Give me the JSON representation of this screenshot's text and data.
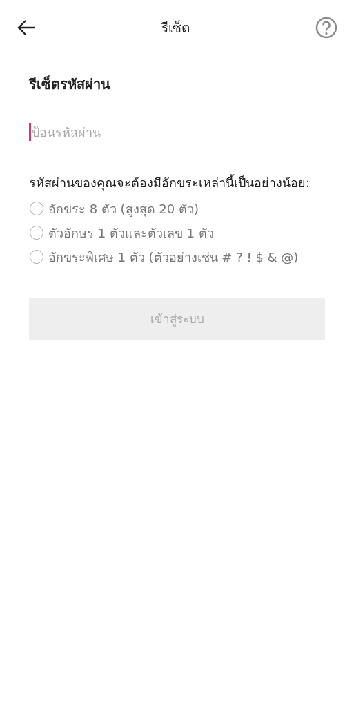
{
  "header": {
    "title": "รีเซ็ต"
  },
  "heading": "รีเซ็ตรหัสผ่าน",
  "password_field": {
    "placeholder": "ป้อนรหัสผ่าน",
    "focused": true
  },
  "requirements_intro": "รหัสผ่านของคุณจะต้องมีอักขระเหล่านี้เป็นอย่างน้อย:",
  "requirements": [
    {
      "label": "อักขระ 8 ตัว (สูงสุด 20 ตัว)",
      "checked": false
    },
    {
      "label": "ตัวอักษร 1 ตัวและตัวเลข 1 ตัว",
      "checked": false
    },
    {
      "label": "อักขระพิเศษ 1 ตัว (ตัวอย่างเช่น # ? ! $ & @)",
      "checked": false
    }
  ],
  "submit_button": {
    "label": "เข้าสู่ระบบ",
    "disabled": true
  }
}
